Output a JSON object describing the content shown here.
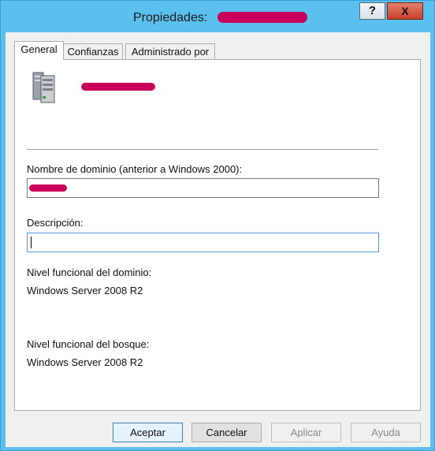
{
  "window": {
    "title": "Propiedades:",
    "help_glyph": "?",
    "close_glyph": "X"
  },
  "tabs": [
    {
      "label": "General",
      "active": true
    },
    {
      "label": "Confianzas",
      "active": false
    },
    {
      "label": "Administrado por",
      "active": false
    }
  ],
  "general": {
    "icon": "server-icon",
    "netbios_label": "Nombre de dominio (anterior a Windows 2000):",
    "description_label": "Descripción:",
    "description_value": "",
    "domain_level_label": "Nivel funcional del dominio:",
    "domain_level_value": "Windows Server 2008 R2",
    "forest_level_label": "Nivel funcional del bosque:",
    "forest_level_value": "Windows Server 2008 R2"
  },
  "buttons": {
    "ok": "Aceptar",
    "cancel": "Cancelar",
    "apply": "Aplicar",
    "help": "Ayuda"
  },
  "colors": {
    "frame": "#5cc0ee",
    "redaction": "#c8005a",
    "close_button": "#c6412a"
  }
}
